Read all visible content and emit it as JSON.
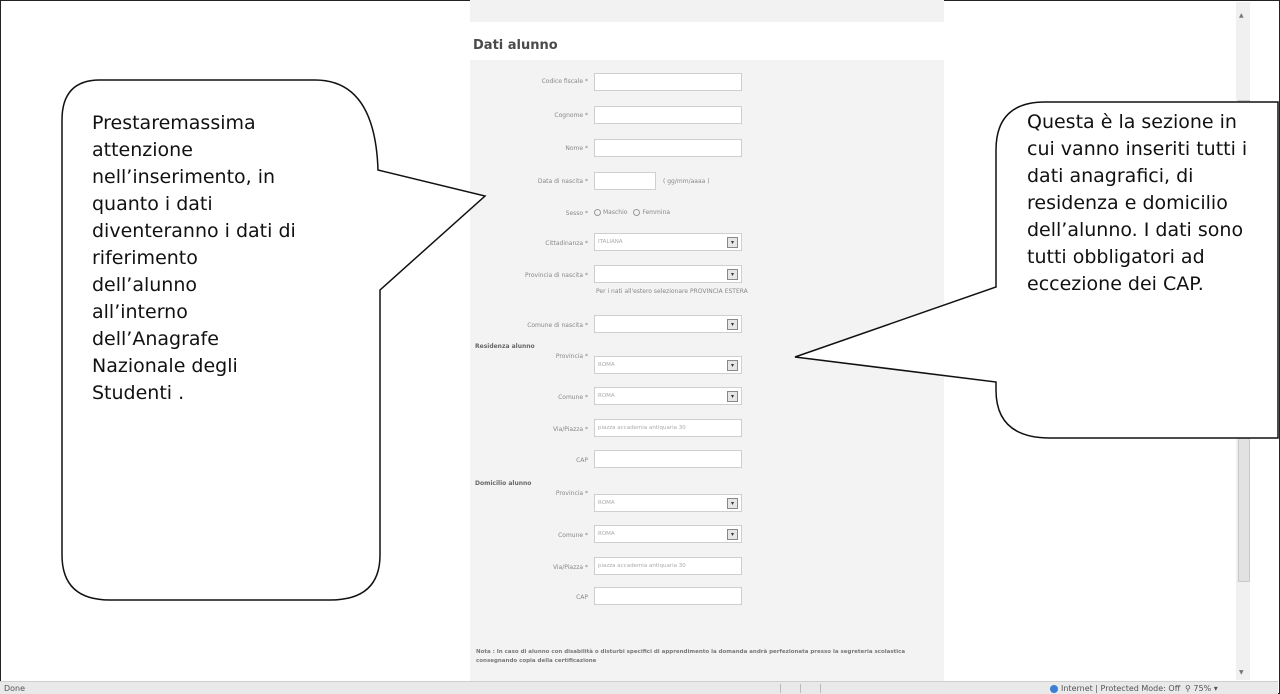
{
  "section_title": "Dati alunno",
  "fields": {
    "codice_fiscale": "Codice fiscale *",
    "cognome": "Cognome *",
    "nome": "Nome *",
    "data_nascita": "Data di nascita *",
    "data_hint": "( gg/mm/aaaa )",
    "sesso": "Sesso *",
    "maschio": "Maschio",
    "femmina": "Femmina",
    "cittadinanza": "Cittadinanza *",
    "cittadinanza_value": "ITALIANA",
    "provincia_nascita": "Provincia di nascita *",
    "provincia_hint": "Per i nati all'estero selezionare PROVINCIA ESTERA",
    "comune_nascita": "Comune di nascita *"
  },
  "residenza": {
    "heading": "Residenza alunno",
    "provincia": "Provincia *",
    "provincia_value": "ROMA",
    "comune": "Comune *",
    "comune_value": "ROMA",
    "via": "Via/Piazza *",
    "via_value": "piazza accademia antiquaria 30",
    "cap": "CAP"
  },
  "domicilio": {
    "heading": "Domicilio alunno",
    "provincia": "Provincia *",
    "provincia_value": "ROMA",
    "comune": "Comune *",
    "comune_value": "ROMA",
    "via": "Via/Piazza *",
    "via_value": "piazza accademia antiquaria 30",
    "cap": "CAP"
  },
  "note": "Nota : In caso di alunno con disabilità o disturbi specifici di apprendimento la domanda andrà perfezionata presso la segreteria scolastica consegnando copia della certificazione",
  "status": {
    "left": "Done",
    "zone": "Internet | Protected Mode: Off",
    "zoom": "75%"
  },
  "callout_left": {
    "lines": [
      "Prestaremassima",
      "attenzione",
      "nell’inserimento, in",
      "quanto i dati",
      "diventeranno i dati di",
      "riferimento",
      "dell’alunno",
      "all’interno",
      "dell’Anagrafe",
      "Nazionale degli",
      "Studenti ."
    ]
  },
  "callout_right": {
    "lines": [
      "Questa è la sezione in",
      "cui vanno inseriti tutti i",
      "dati anagrafici, di",
      "residenza e domicilio",
      "dell’alunno. I dati sono",
      "tutti obbligatori ad",
      "eccezione dei CAP."
    ]
  }
}
